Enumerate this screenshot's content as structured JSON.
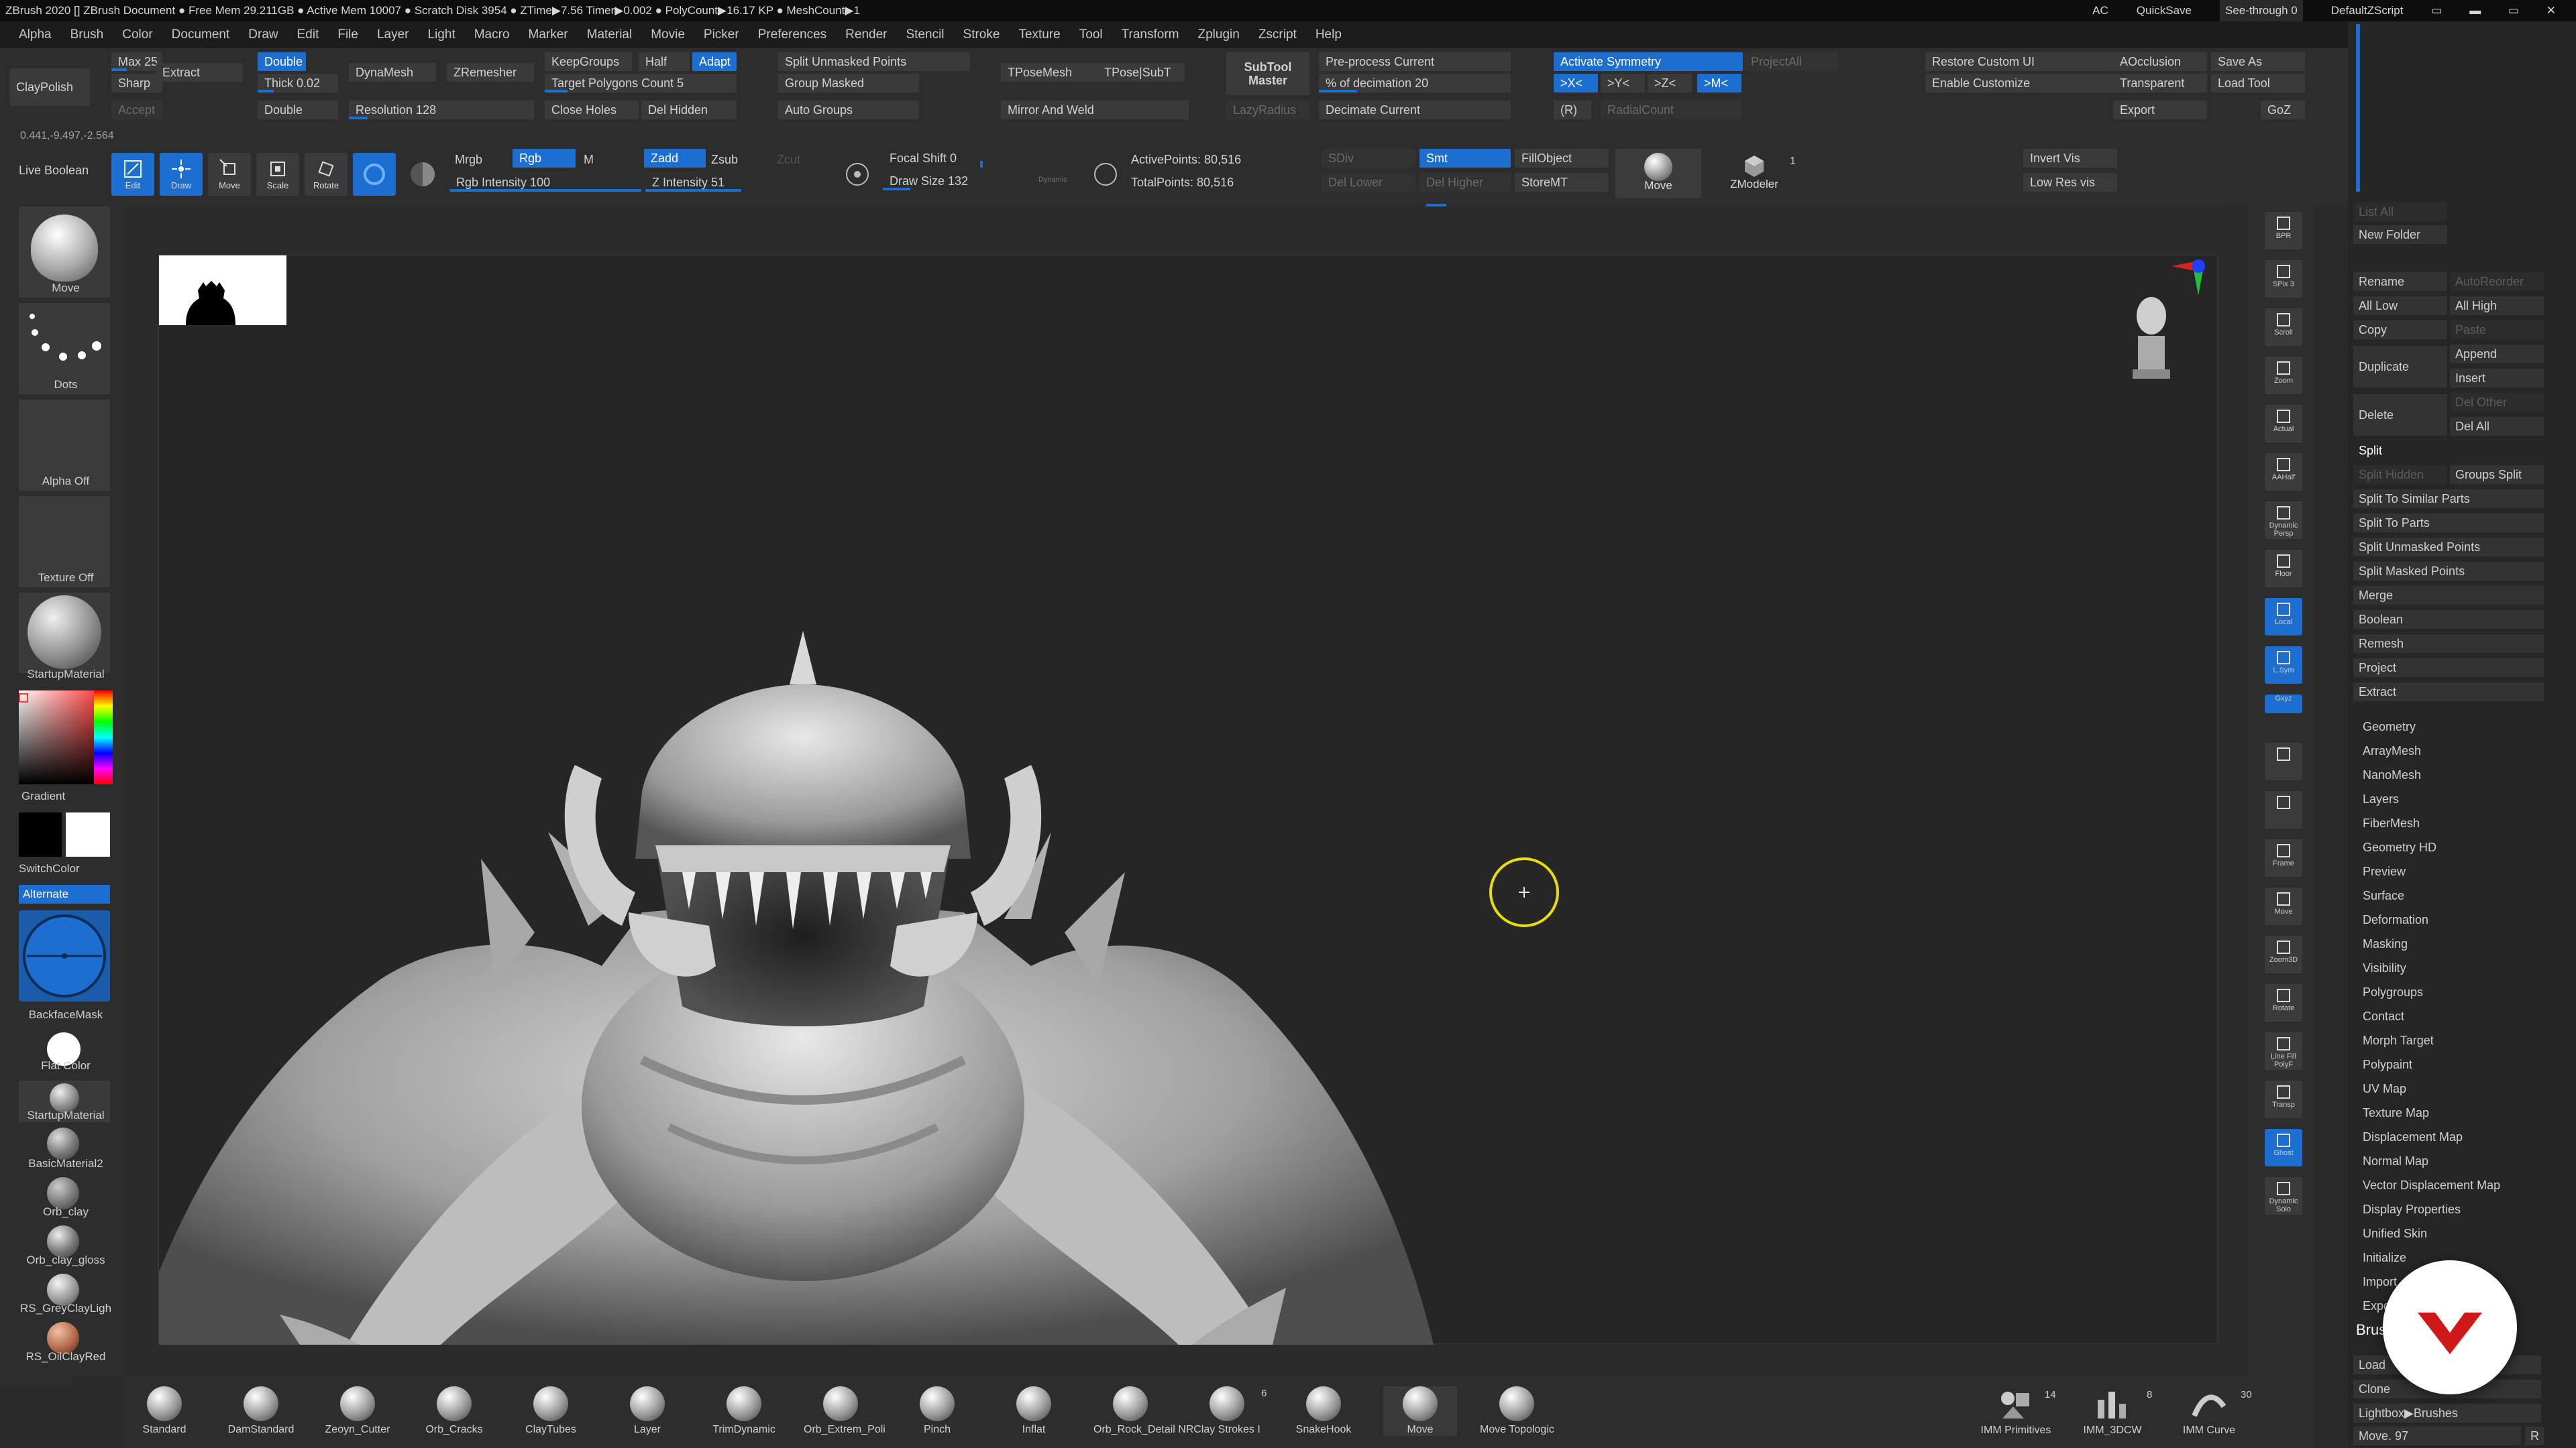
{
  "titlebar": {
    "left": "ZBrush 2020 [] ZBrush Document  ● Free Mem 29.211GB ● Active Mem 10007 ● Scratch Disk 3954 ● ZTime▶7.56 Timer▶0.002 ● PolyCount▶16.17 KP ● MeshCount▶1",
    "ac": "AC",
    "quicksave": "QuickSave",
    "seethrough": "See-through 0",
    "script": "DefaultZScript"
  },
  "menu": [
    "Alpha",
    "Brush",
    "Color",
    "Document",
    "Draw",
    "Edit",
    "File",
    "Layer",
    "Light",
    "Macro",
    "Marker",
    "Material",
    "Movie",
    "Picker",
    "Preferences",
    "Render",
    "Stencil",
    "Stroke",
    "Texture",
    "Tool",
    "Transform",
    "Zplugin",
    "Zscript",
    "Help"
  ],
  "shelf": {
    "claypolish": "ClayPolish",
    "max": "Max 25",
    "sharp": "Sharp",
    "extract": "Extract",
    "double_on": "Double",
    "thick": "Thick 0.02",
    "double": "Double",
    "accept": "Accept",
    "dynamesh": "DynaMesh",
    "zremesher": "ZRemesher",
    "resolution": "Resolution 128",
    "keepgroups": "KeepGroups",
    "half": "Half",
    "adapt": "Adapt",
    "target": "Target Polygons Count 5",
    "closeholes": "Close Holes",
    "delhidden": "Del Hidden",
    "split_unmasked": "Split Unmasked Points",
    "group_masked": "Group Masked",
    "auto_groups": "Auto Groups",
    "tposemesh": "TPoseMesh",
    "tpose_subt": "TPose|SubT",
    "mirror_weld": "Mirror And Weld",
    "subtool_master": "SubTool Master",
    "lazyradius": "LazyRadius",
    "preprocess": "Pre-process Current",
    "decimation": "% of decimation 20",
    "decimate": "Decimate Current",
    "activate_sym": "Activate Symmetry",
    "projectall": "ProjectAll",
    "x": ">X<",
    "y": ">Y<",
    "z": ">Z<",
    "m": ">M<",
    "r": "(R)",
    "radialcount": "RadialCount",
    "restore_ui": "Restore Custom UI",
    "enable_custom": "Enable Customize",
    "aocclusion": "AOcclusion",
    "transparent": "Transparent",
    "export": "Export",
    "saveas": "Save As",
    "loadtool": "Load Tool",
    "goz": "GoZ",
    "coords": "0.441,-9.497,-2.564",
    "liveboolean": "Live Boolean",
    "edit": "Edit",
    "draw": "Draw",
    "move": "Move",
    "scale": "Scale",
    "rotate": "Rotate",
    "mrgb": "Mrgb",
    "rgb": "Rgb",
    "m_btn": "M",
    "rgb_intensity": "Rgb Intensity 100",
    "zadd": "Zadd",
    "zsub": "Zsub",
    "zcut": "Zcut",
    "z_intensity": "Z Intensity 51",
    "focal": "Focal Shift 0",
    "drawsize": "Draw Size 132",
    "dynamic": "Dynamic",
    "activepoints": "ActivePoints: 80,516",
    "totalpoints": "TotalPoints: 80,516",
    "sdiv": "SDiv",
    "smt": "Smt",
    "fillobject": "FillObject",
    "dellower": "Del Lower",
    "delhigher": "Del Higher",
    "storemt": "StoreMT",
    "move_brush": "Move",
    "zmodeler": "ZModeler",
    "one": "1",
    "invertvis": "Invert Vis",
    "lowresvis": "Low Res vis"
  },
  "left": {
    "move": "Move",
    "dots": "Dots",
    "alpha": "Alpha Off",
    "texture": "Texture Off",
    "startup": "StartupMaterial",
    "gradient": "Gradient",
    "switchcolor": "SwitchColor",
    "alternate": "Alternate",
    "backface": "BackfaceMask",
    "flat": "Flat Color",
    "startup2": "StartupMaterial",
    "basic": "BasicMaterial2",
    "orbclay": "Orb_clay",
    "orbgloss": "Orb_clay_gloss",
    "rsgrey": "RS_GreyClayLigh",
    "rsoil": "RS_OilClayRed"
  },
  "rightshelf": [
    "BPR",
    "SPix 3",
    "Scroll",
    "Zoom",
    "Actual",
    "AAHalf",
    "Dynamic Persp",
    "Floor",
    "Local",
    "L.Sym",
    "Gxyz",
    "",
    "",
    "Frame",
    "Move",
    "Zoom3D",
    "Rotate",
    "Line Fill PolyF",
    "Transp",
    "Ghost",
    "Dynamic Solo"
  ],
  "rightpanel": {
    "listall": "List All",
    "newfolder": "New Folder",
    "rename": "Rename",
    "autoreorder": "AutoReorder",
    "alllow": "All Low",
    "allhigh": "All High",
    "copy": "Copy",
    "paste": "Paste",
    "duplicate": "Duplicate",
    "append": "Append",
    "insert": "Insert",
    "delete": "Delete",
    "delother": "Del Other",
    "delall": "Del All",
    "split": "Split",
    "splithidden": "Split Hidden",
    "groupssplit": "Groups Split",
    "items": [
      "Split To Similar Parts",
      "Split To Parts",
      "Split Unmasked Points",
      "Split Masked Points",
      "Merge",
      "Boolean",
      "Remesh",
      "Project",
      "Extract"
    ],
    "subpalettes": [
      "Geometry",
      "ArrayMesh",
      "NanoMesh",
      "Layers",
      "FiberMesh",
      "Geometry HD",
      "Preview",
      "Surface",
      "Deformation",
      "Masking",
      "Visibility",
      "Polygroups",
      "Contact",
      "Morph Target",
      "Polypaint",
      "UV Map",
      "Texture Map",
      "Displacement Map",
      "Normal Map",
      "Vector Displacement Map",
      "Display Properties",
      "Unified Skin",
      "Initialize",
      "Import",
      "Export"
    ],
    "brush": "Brush",
    "load": "Load",
    "clone": "Clone",
    "lightbox": "Lightbox▶Brushes",
    "moveval": "Move. 97",
    "r": "R"
  },
  "bottom": [
    "Standard",
    "DamStandard",
    "Zeoyn_Cutter",
    "Orb_Cracks",
    "ClayTubes",
    "Layer",
    "TrimDynamic",
    "Orb_Extrem_Poli",
    "Pinch",
    "Inflat",
    "Orb_Rock_Detail NR",
    "Clay Strokes I",
    "SnakeHook",
    "Move",
    "Move Topologic"
  ],
  "bottom_counts": {
    "claystrokes": "6",
    "imm_primitives": "14",
    "imm_3dcw": "8",
    "imm_curve": "30"
  },
  "bottom_right": [
    "IMM Primitives",
    "IMM_3DCW",
    "IMM Curve"
  ],
  "accent": "#1c6fd0"
}
